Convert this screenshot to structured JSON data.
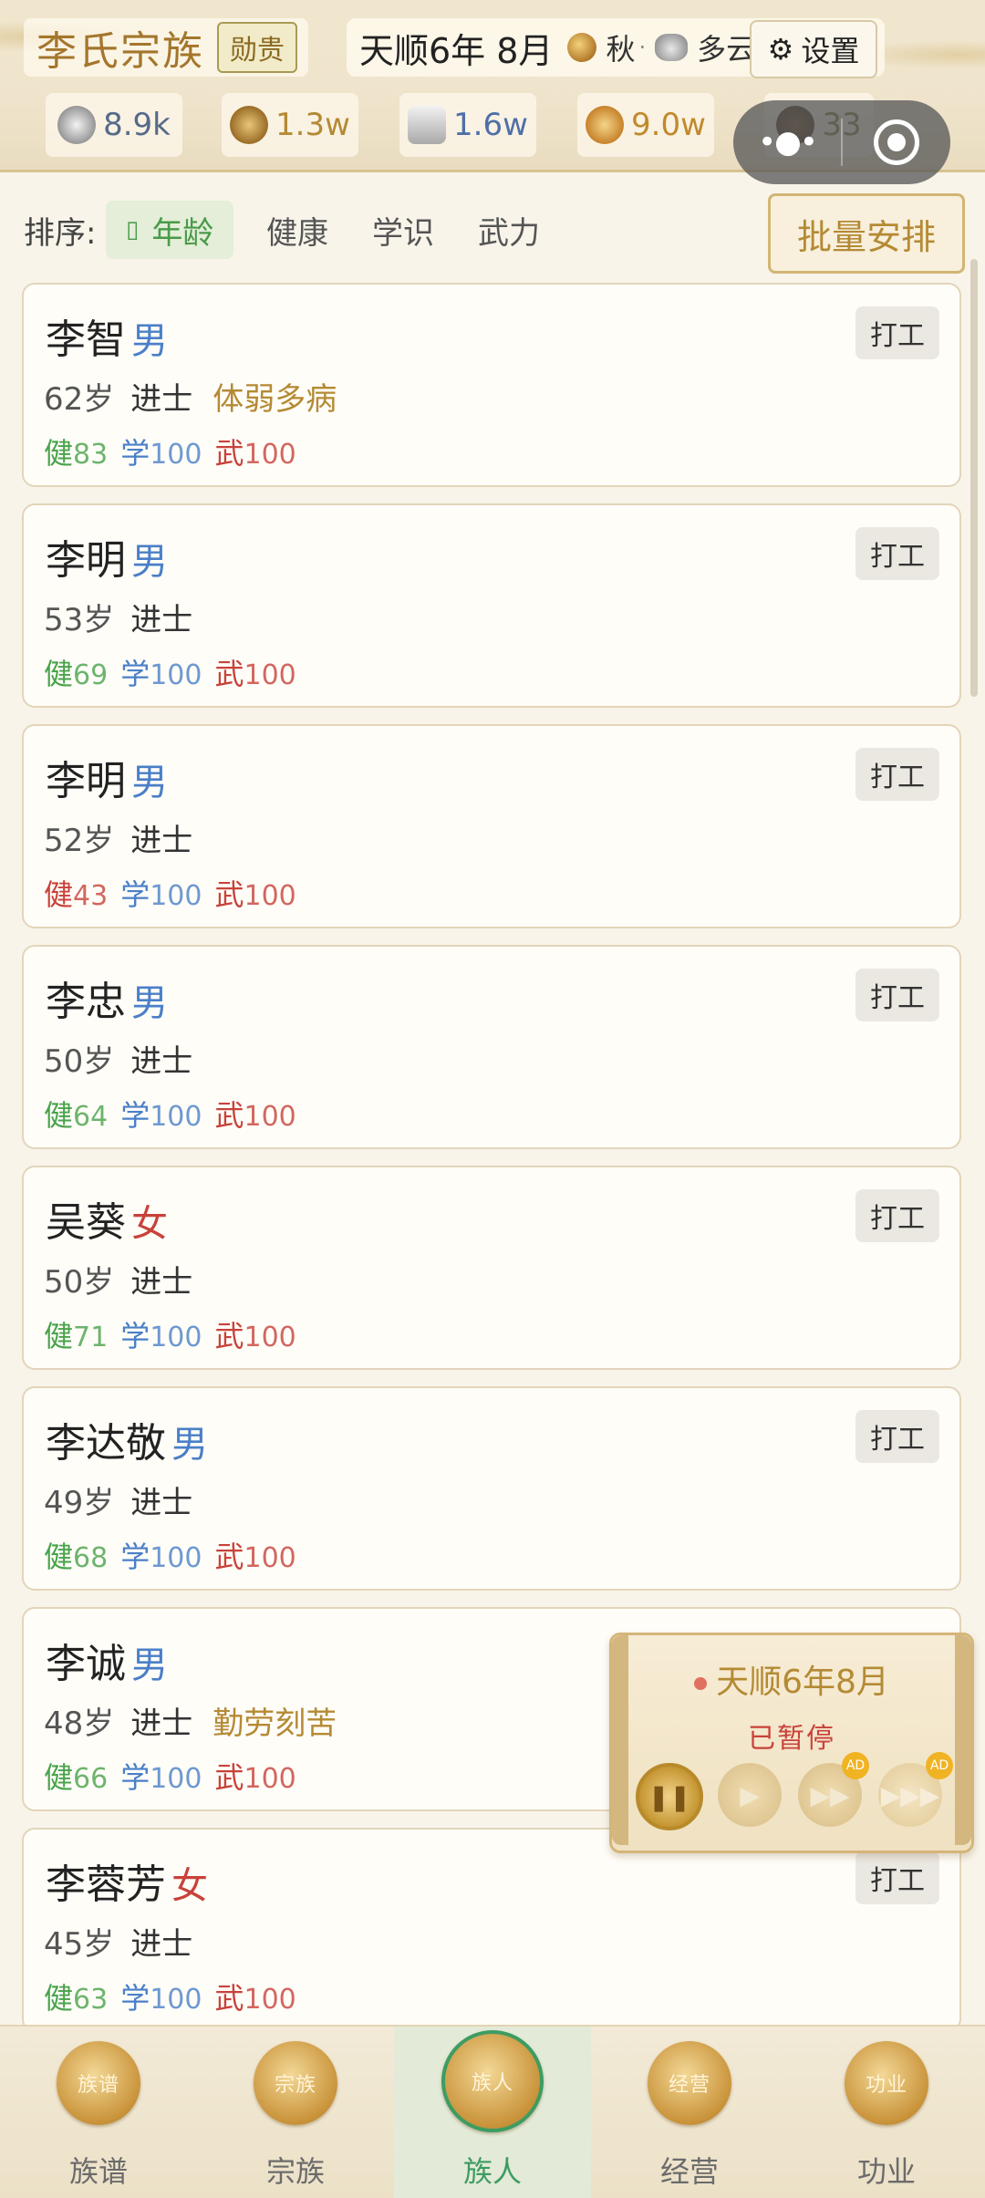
{
  "header": {
    "clan_name": "李氏宗族",
    "rank": "勋贵",
    "date": "天顺6年 8月",
    "season": "秋",
    "weather": "多云",
    "settings_label": "设置",
    "resources": [
      {
        "icon": "silver-icon",
        "value": "8.9k"
      },
      {
        "icon": "money-bag-icon",
        "value": "1.3w"
      },
      {
        "icon": "scroll-icon",
        "value": "1.6w"
      },
      {
        "icon": "fame-icon",
        "value": "9.0w"
      },
      {
        "icon": "people-icon",
        "value": "33"
      }
    ],
    "capsule_menu": "•●•"
  },
  "sort": {
    "label": "排序:",
    "options": [
      "年龄",
      "健康",
      "学识",
      "武力"
    ],
    "active": "年龄",
    "batch_label": "批量安排"
  },
  "members": [
    {
      "name": "李智",
      "sex": "男",
      "age": "62岁",
      "degree": "进士",
      "trait": "体弱多病",
      "health": "83",
      "study": "100",
      "martial": "100",
      "action": "打工"
    },
    {
      "name": "李明",
      "sex": "男",
      "age": "53岁",
      "degree": "进士",
      "trait": "",
      "health": "69",
      "study": "100",
      "martial": "100",
      "action": "打工"
    },
    {
      "name": "李明",
      "sex": "男",
      "age": "52岁",
      "degree": "进士",
      "trait": "",
      "health": "43",
      "study": "100",
      "martial": "100",
      "action": "打工"
    },
    {
      "name": "李忠",
      "sex": "男",
      "age": "50岁",
      "degree": "进士",
      "trait": "",
      "health": "64",
      "study": "100",
      "martial": "100",
      "action": "打工"
    },
    {
      "name": "吴葵",
      "sex": "女",
      "age": "50岁",
      "degree": "进士",
      "trait": "",
      "health": "71",
      "study": "100",
      "martial": "100",
      "action": "打工"
    },
    {
      "name": "李达敬",
      "sex": "男",
      "age": "49岁",
      "degree": "进士",
      "trait": "",
      "health": "68",
      "study": "100",
      "martial": "100",
      "action": "打工"
    },
    {
      "name": "李诚",
      "sex": "男",
      "age": "48岁",
      "degree": "进士",
      "trait": "勤劳刻苦",
      "health": "66",
      "study": "100",
      "martial": "100",
      "action": ""
    },
    {
      "name": "李蓉芳",
      "sex": "女",
      "age": "45岁",
      "degree": "进士",
      "trait": "",
      "health": "63",
      "study": "100",
      "martial": "100",
      "action": "打工"
    }
  ],
  "stat_labels": {
    "health": "健",
    "study": "学",
    "martial": "武"
  },
  "time_panel": {
    "date": "天顺6年8月",
    "status": "已暂停",
    "ad_label": "AD"
  },
  "nav": [
    {
      "label": "族谱",
      "icon_text": "族谱"
    },
    {
      "label": "宗族",
      "icon_text": "宗族"
    },
    {
      "label": "族人",
      "icon_text": "族人"
    },
    {
      "label": "经营",
      "icon_text": "经营"
    },
    {
      "label": "功业",
      "icon_text": "功业"
    }
  ],
  "colors": {
    "accent_gold": "#b48a34",
    "active_green": "#3d9c62",
    "male_blue": "#4a7fc8",
    "female_red": "#c8423a"
  }
}
